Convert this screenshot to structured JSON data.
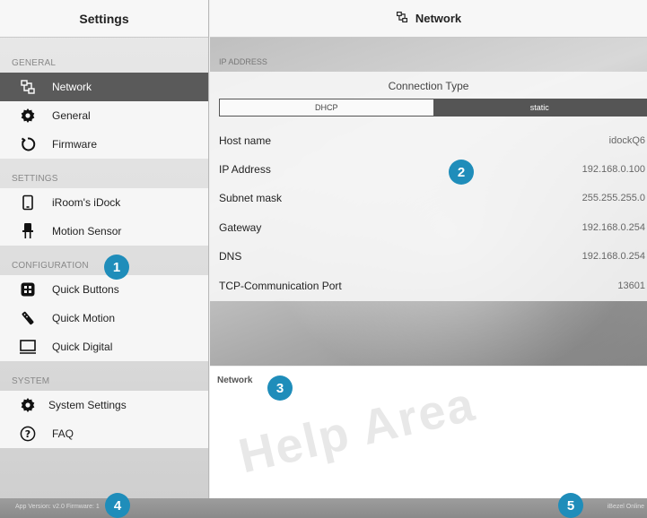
{
  "sidebar": {
    "title": "Settings",
    "sections": [
      {
        "label": "GENERAL",
        "items": [
          {
            "label": "Network",
            "icon": "network-icon",
            "active": true
          },
          {
            "label": "General",
            "icon": "gear-icon"
          },
          {
            "label": "Firmware",
            "icon": "refresh-icon"
          }
        ]
      },
      {
        "label": "SETTINGS",
        "items": [
          {
            "label": "iRoom's iDock",
            "icon": "tablet-icon"
          },
          {
            "label": "Motion Sensor",
            "icon": "sensor-icon"
          }
        ]
      },
      {
        "label": "CONFIGURATION",
        "items": [
          {
            "label": "Quick Buttons",
            "icon": "grid-buttons-icon"
          },
          {
            "label": "Quick Motion",
            "icon": "remote-icon"
          },
          {
            "label": "Quick Digital",
            "icon": "monitor-icon"
          }
        ]
      },
      {
        "label": "SYSTEM",
        "items": [
          {
            "label": "System Settings",
            "icon": "gear-icon"
          },
          {
            "label": "FAQ",
            "icon": "question-icon"
          }
        ]
      }
    ]
  },
  "main": {
    "title": "Network",
    "ip_section_label": "IP ADDRESS",
    "connection_type_label": "Connection Type",
    "connection_options": [
      "DHCP",
      "static"
    ],
    "selected_connection": "static",
    "rows": [
      {
        "label": "Host name",
        "value": "idockQ6"
      },
      {
        "label": "IP Address",
        "value": "192.168.0.100"
      },
      {
        "label": "Subnet mask",
        "value": "255.255.255.0"
      },
      {
        "label": "Gateway",
        "value": "192.168.0.254"
      },
      {
        "label": "DNS",
        "value": "192.168.0.254"
      },
      {
        "label": "TCP-Communication Port",
        "value": "13601"
      }
    ]
  },
  "help": {
    "title": "Network",
    "watermark": "Help Area"
  },
  "footer": {
    "version": "App Version: v2.0 Firmware: 1",
    "status": "iBezel Online"
  },
  "callouts": [
    "1",
    "2",
    "3",
    "4",
    "5"
  ],
  "colors": {
    "accent": "#1f8dba",
    "active_item": "#5a5a5a"
  }
}
